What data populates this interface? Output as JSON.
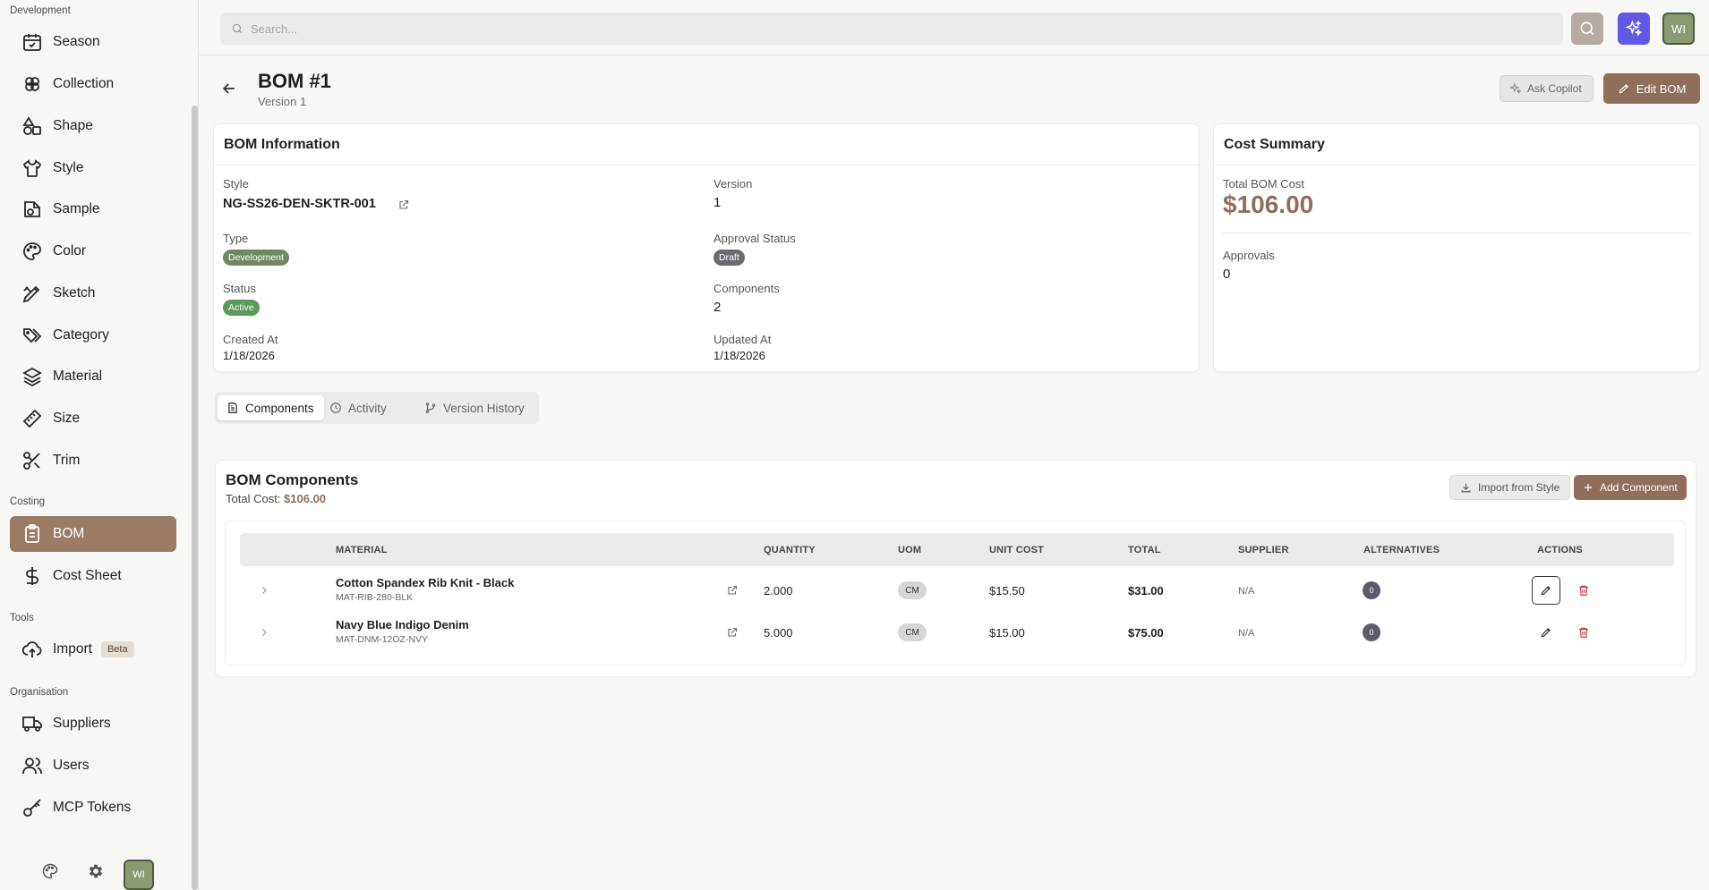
{
  "sidebar": {
    "sections": {
      "development": "Development",
      "costing": "Costing",
      "tools": "Tools",
      "organisation": "Organisation"
    },
    "items": {
      "season": "Season",
      "collection": "Collection",
      "shape": "Shape",
      "style": "Style",
      "sample": "Sample",
      "color": "Color",
      "sketch": "Sketch",
      "category": "Category",
      "material": "Material",
      "size": "Size",
      "trim": "Trim",
      "bom": "BOM",
      "cost_sheet": "Cost Sheet",
      "import": "Import",
      "import_badge": "Beta",
      "suppliers": "Suppliers",
      "users": "Users",
      "mcp_tokens": "MCP Tokens"
    },
    "avatar_initials": "WI"
  },
  "topbar": {
    "search_placeholder": "Search...",
    "avatar_initials": "WI"
  },
  "header": {
    "title": "BOM #1",
    "subtitle": "Version 1",
    "ask_copilot": "Ask Copilot",
    "edit_bom": "Edit BOM"
  },
  "bom_info": {
    "title": "BOM Information",
    "style_label": "Style",
    "style_value": "NG-SS26-DEN-SKTR-001",
    "version_label": "Version",
    "version_value": "1",
    "type_label": "Type",
    "type_value": "Development",
    "approval_label": "Approval Status",
    "approval_value": "Draft",
    "status_label": "Status",
    "status_value": "Active",
    "components_label": "Components",
    "components_value": "2",
    "created_label": "Created At",
    "created_value": "1/18/2026",
    "updated_label": "Updated At",
    "updated_value": "1/18/2026"
  },
  "cost_summary": {
    "title": "Cost Summary",
    "total_label": "Total BOM Cost",
    "total_value": "$106.00",
    "approvals_label": "Approvals",
    "approvals_value": "0"
  },
  "tabs": {
    "components": "Components",
    "activity": "Activity",
    "version_history": "Version History"
  },
  "components": {
    "title": "BOM Components",
    "total_prefix": "Total Cost:",
    "total_value": "$106.00",
    "import_btn": "Import from Style",
    "add_btn": "Add Component",
    "columns": {
      "material": "MATERIAL",
      "quantity": "QUANTITY",
      "uom": "UOM",
      "unit_cost": "UNIT COST",
      "total": "TOTAL",
      "supplier": "SUPPLIER",
      "alternatives": "ALTERNATIVES",
      "actions": "ACTIONS"
    },
    "rows": [
      {
        "name": "Cotton Spandex Rib Knit - Black",
        "code": "MAT-RIB-280-BLK",
        "quantity": "2.000",
        "uom": "CM",
        "unit_cost": "$15.50",
        "total": "$31.00",
        "supplier": "N/A",
        "alternatives": "0"
      },
      {
        "name": "Navy Blue Indigo Denim",
        "code": "MAT-DNM-12OZ-NVY",
        "quantity": "5.000",
        "uom": "CM",
        "unit_cost": "$15.00",
        "total": "$75.00",
        "supplier": "N/A",
        "alternatives": "0"
      }
    ]
  },
  "colors": {
    "accent": "#8f6f5c",
    "active_nav": "#9a7b66",
    "copilot": "#6358e6"
  }
}
